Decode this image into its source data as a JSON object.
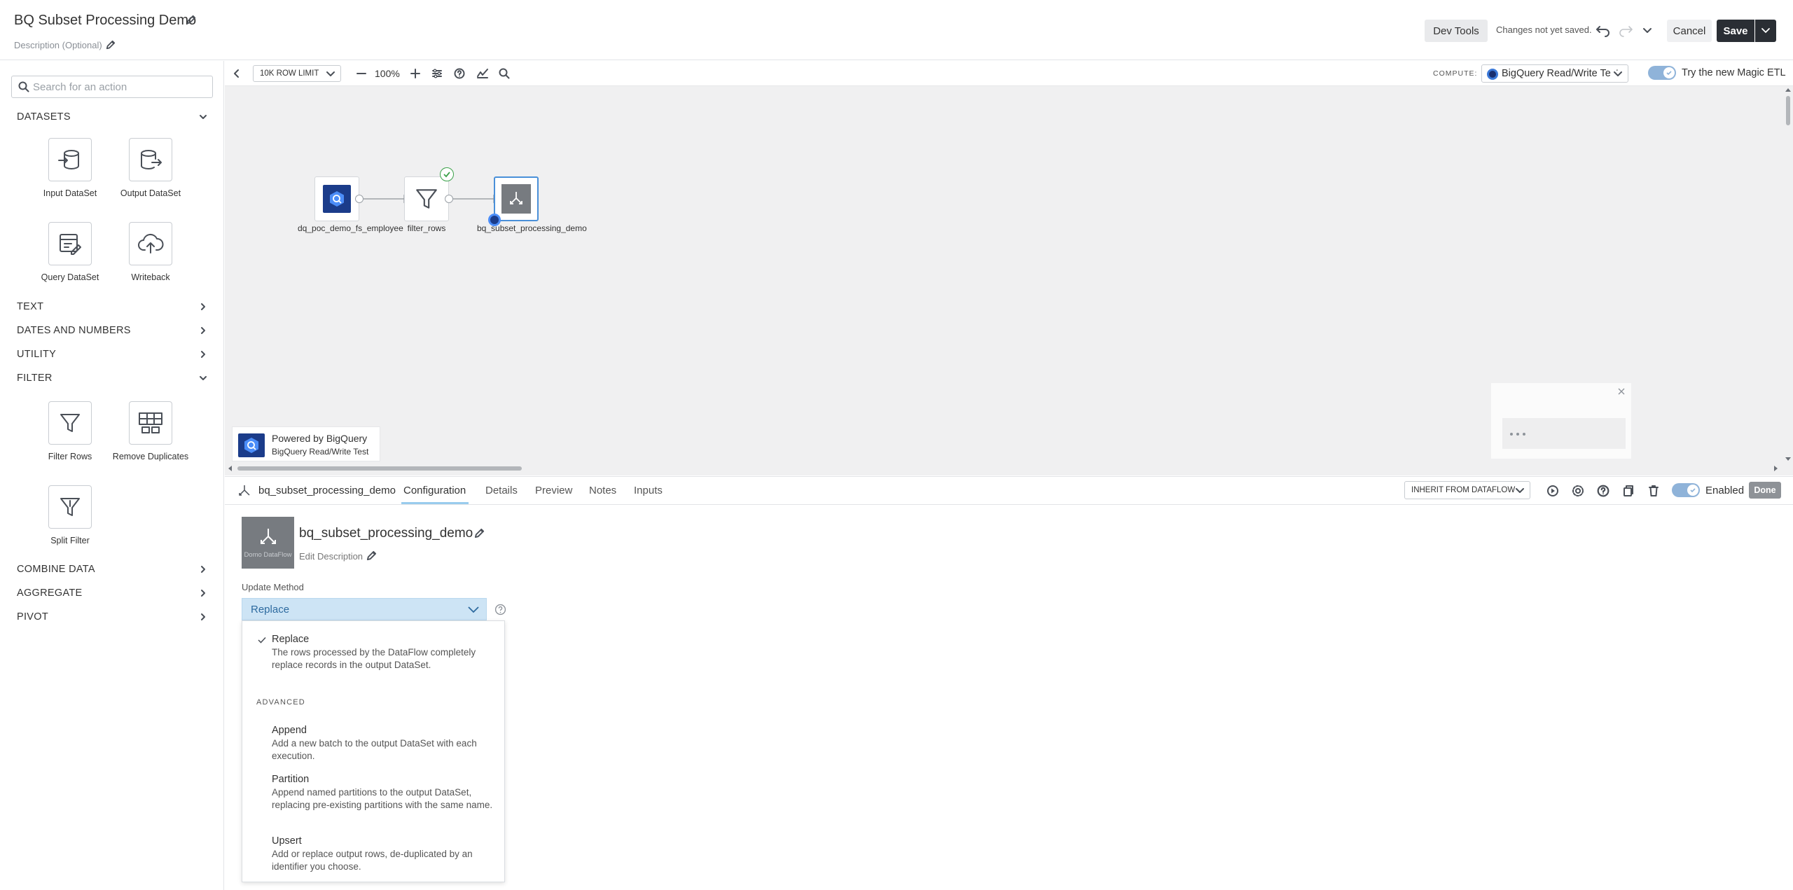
{
  "header": {
    "title": "BQ Subset Processing Demo",
    "description_placeholder": "Description (Optional)",
    "dev_tools": "Dev Tools",
    "save_status": "Changes not yet saved.",
    "cancel": "Cancel",
    "save": "Save"
  },
  "sidebar": {
    "search_placeholder": "Search for an action",
    "sections": {
      "datasets": "DATASETS",
      "text": "TEXT",
      "dates": "DATES AND NUMBERS",
      "utility": "UTILITY",
      "filter": "FILTER",
      "combine": "COMBINE DATA",
      "aggregate": "AGGREGATE",
      "pivot": "PIVOT"
    },
    "tiles": {
      "input_dataset": "Input DataSet",
      "output_dataset": "Output DataSet",
      "query_dataset": "Query DataSet",
      "writeback": "Writeback",
      "filter_rows": "Filter Rows",
      "remove_duplicates": "Remove Duplicates",
      "split_filter": "Split Filter"
    }
  },
  "canvas": {
    "row_limit": "10K ROW LIMIT",
    "zoom": "100%",
    "compute_label": "COMPUTE:",
    "compute_value": "BigQuery Read/Write Test",
    "magic_etl": "Try the new Magic ETL",
    "nodes": {
      "input": "dq_poc_demo_fs_employee",
      "filter": "filter_rows",
      "output": "bq_subset_processing_demo"
    },
    "powered_by": "Powered by BigQuery",
    "powered_sub": "BigQuery Read/Write Test"
  },
  "panel": {
    "tile_name": "bq_subset_processing_demo",
    "tabs": {
      "configuration": "Configuration",
      "details": "Details",
      "preview": "Preview",
      "notes": "Notes",
      "inputs": "Inputs"
    },
    "inherit": "INHERIT FROM DATAFLOW",
    "enabled": "Enabled",
    "done": "Done",
    "icon_caption": "Domo DataFlow",
    "config_title": "bq_subset_processing_demo",
    "edit_description": "Edit Description",
    "update_method_label": "Update Method",
    "update_method_value": "Replace",
    "advanced_label": "ADVANCED",
    "options": {
      "replace": {
        "name": "Replace",
        "desc": "The rows processed by the DataFlow completely replace records in the output DataSet."
      },
      "append": {
        "name": "Append",
        "desc": "Add a new batch to the output DataSet with each execution."
      },
      "partition": {
        "name": "Partition",
        "desc": "Append named partitions to the output DataSet, replacing pre-existing partitions with the same name."
      },
      "upsert": {
        "name": "Upsert",
        "desc": "Add or replace output rows, de-duplicated by an identifier you choose."
      }
    }
  }
}
